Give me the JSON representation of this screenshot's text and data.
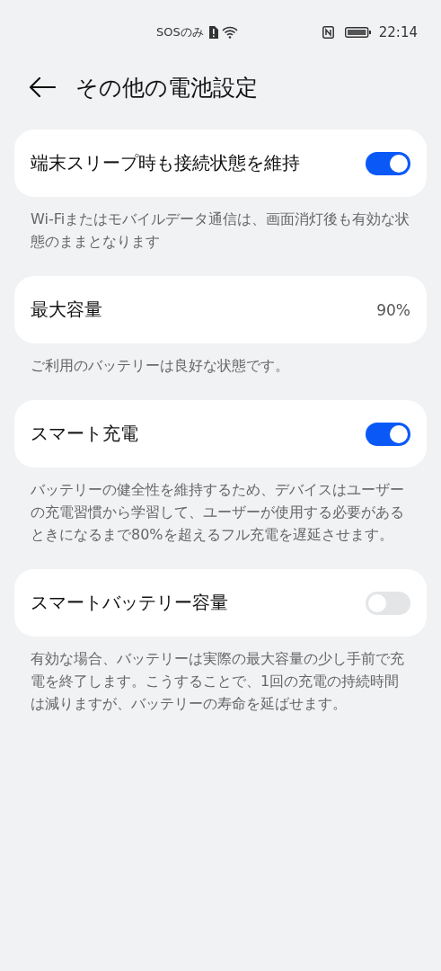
{
  "status_bar": {
    "carrier": "SOSのみ",
    "time": "22:14"
  },
  "header": {
    "title": "その他の電池設定"
  },
  "sections": [
    {
      "kind": "toggle",
      "label": "端末スリープ時も接続状態を維持",
      "on": true,
      "description": "Wi-Fiまたはモバイルデータ通信は、画面消灯後も有効な状態のままとなります"
    },
    {
      "kind": "value",
      "label": "最大容量",
      "value": "90%",
      "description": "ご利用のバッテリーは良好な状態です。"
    },
    {
      "kind": "toggle",
      "label": "スマート充電",
      "on": true,
      "description": "バッテリーの健全性を維持するため、デバイスはユーザーの充電習慣から学習して、ユーザーが使用する必要があるときになるまで80%を超えるフル充電を遅延させます。"
    },
    {
      "kind": "toggle",
      "label": "スマートバッテリー容量",
      "on": false,
      "description": "有効な場合、バッテリーは実際の最大容量の少し手前で充電を終了します。こうすることで、1回の充電の持続時間は減りますが、バッテリーの寿命を延ばせます。"
    }
  ]
}
